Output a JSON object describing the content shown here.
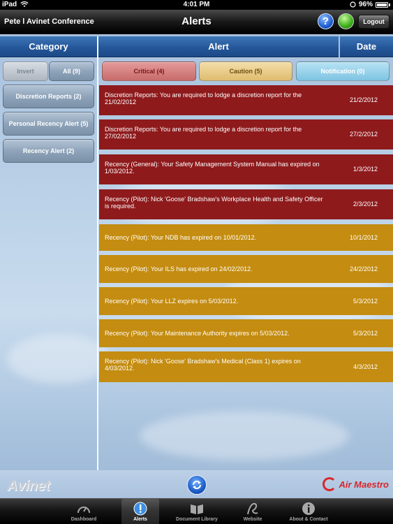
{
  "status_bar": {
    "device": "iPad",
    "time": "4:01 PM",
    "battery": "96%"
  },
  "nav": {
    "org": "Pete l Avinet Conference",
    "title": "Alerts",
    "logout_label": "Logout",
    "help_label": "?"
  },
  "columns": {
    "category": "Category",
    "alert": "Alert",
    "date": "Date"
  },
  "category_buttons": {
    "invert": "Invert",
    "all": "All (9)"
  },
  "categories": [
    {
      "label": "Discretion Reports (2)"
    },
    {
      "label": "Personal Recency Alert (5)"
    },
    {
      "label": "Recency Alert (2)"
    }
  ],
  "filters": {
    "critical": "Critical (4)",
    "caution": "Caution (5)",
    "notification": "Notification (0)"
  },
  "alerts": [
    {
      "severity": "critical",
      "message": "Discretion Reports: You are required to lodge a discretion report for the 21/02/2012",
      "date": "21/2/2012"
    },
    {
      "severity": "critical",
      "message": "Discretion Reports: You are required to lodge a discretion report for the 27/02/2012",
      "date": "27/2/2012"
    },
    {
      "severity": "critical",
      "message": "Recency (General): Your Safety Management System Manual has expired on 1/03/2012.",
      "date": "1/3/2012"
    },
    {
      "severity": "critical",
      "message": "Recency (Pilot): Nick 'Goose' Bradshaw's Workplace Health and Safety Officer is required.",
      "date": "2/3/2012"
    },
    {
      "severity": "caution",
      "message": "Recency (Pilot): Your NDB has expired on 10/01/2012.",
      "date": "10/1/2012"
    },
    {
      "severity": "caution",
      "message": "Recency (Pilot): Your ILS has expired on 24/02/2012.",
      "date": "24/2/2012"
    },
    {
      "severity": "caution",
      "message": "Recency (Pilot): Your LLZ expires on 5/03/2012.",
      "date": "5/3/2012"
    },
    {
      "severity": "caution",
      "message": "Recency (Pilot): Your Maintenance Authority expires on 5/03/2012.",
      "date": "5/3/2012"
    },
    {
      "severity": "caution",
      "message": "Recency (Pilot): Nick 'Goose' Bradshaw's Medical (Class 1) expires on 4/03/2012.",
      "date": "4/3/2012"
    }
  ],
  "logos": {
    "left": "Avinet",
    "right": "Air Maestro"
  },
  "tabs": [
    {
      "label": "Dashboard",
      "icon": "gauge-icon"
    },
    {
      "label": "Alerts",
      "icon": "exclamation-icon",
      "active": true
    },
    {
      "label": "Document Library",
      "icon": "book-icon"
    },
    {
      "label": "Website",
      "icon": "web-icon"
    },
    {
      "label": "About & Contact",
      "icon": "info-icon"
    }
  ],
  "colors": {
    "critical": "#8e1a1c",
    "caution": "#c48c10",
    "header": "#24579a"
  }
}
